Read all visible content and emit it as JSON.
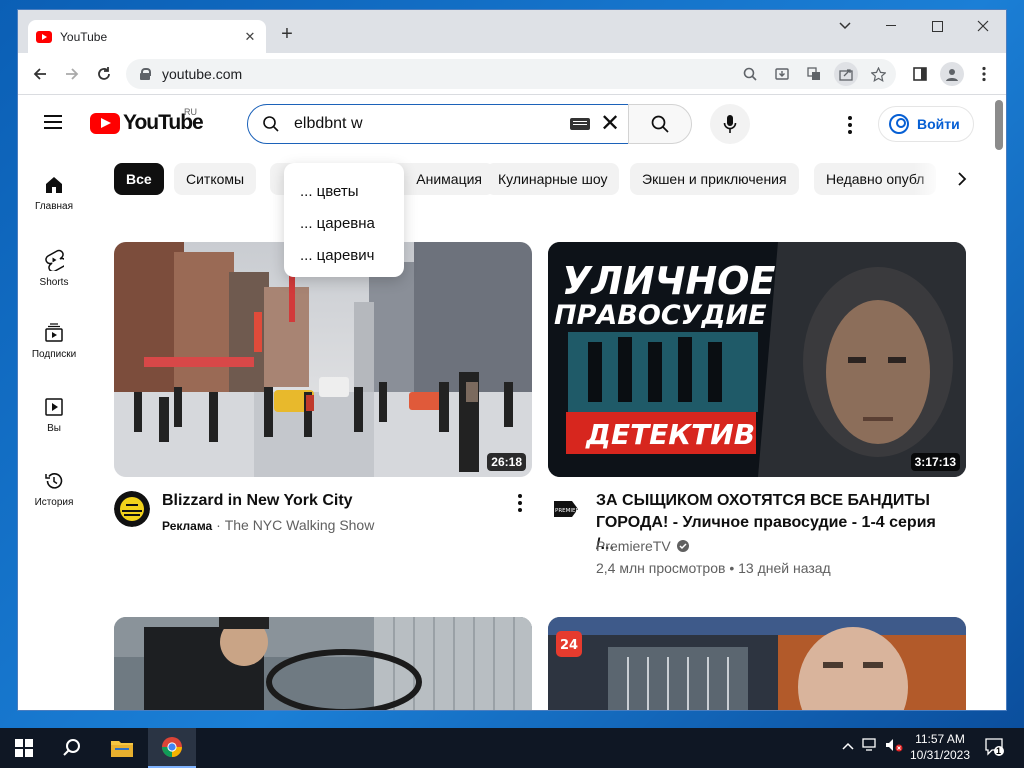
{
  "browser": {
    "tab_title": "YouTube",
    "url": "youtube.com"
  },
  "youtube": {
    "logo_text": "YouTube",
    "region": "RU",
    "search_value": "elbdbnt w",
    "signin_label": "Войти",
    "suggestions": [
      "... цветы",
      "... царевна",
      "... царевич"
    ],
    "sidebar": [
      {
        "label": "Главная",
        "icon": "home-icon"
      },
      {
        "label": "Shorts",
        "icon": "shorts-icon"
      },
      {
        "label": "Подписки",
        "icon": "subscriptions-icon"
      },
      {
        "label": "Вы",
        "icon": "library-icon"
      },
      {
        "label": "История",
        "icon": "history-icon"
      }
    ],
    "chips": [
      "Все",
      "Ситкомы",
      "Анимация",
      "Кулинарные шоу",
      "Экшен и приключения",
      "Недавно опубл"
    ],
    "videos": [
      {
        "title": "Blizzard in New York City",
        "ad_label": "Реклама",
        "channel": "The NYC Walking Show",
        "duration": "26:18"
      },
      {
        "title": "ЗА СЫЩИКОМ ОХОТЯТСЯ ВСЕ БАНДИТЫ ГОРОДА! - Уличное правосудие - 1-4 серия /...",
        "channel": "PremiereTV",
        "stats": "2,4 млн просмотров • 13 дней назад",
        "duration": "3:17:13",
        "thumb_title_line1": "УЛИЧНОЕ",
        "thumb_title_line2": "ПРАВОСУДИЕ",
        "thumb_banner": "ДЕТЕКТИВ",
        "avatar_text": "PREMIERE"
      }
    ],
    "third_thumb_badge": "24"
  },
  "taskbar": {
    "time": "11:57 AM",
    "date": "10/31/2023",
    "notification_count": "1"
  },
  "colors": {
    "accent_blue": "#065fd4",
    "youtube_red": "#ff0000"
  }
}
